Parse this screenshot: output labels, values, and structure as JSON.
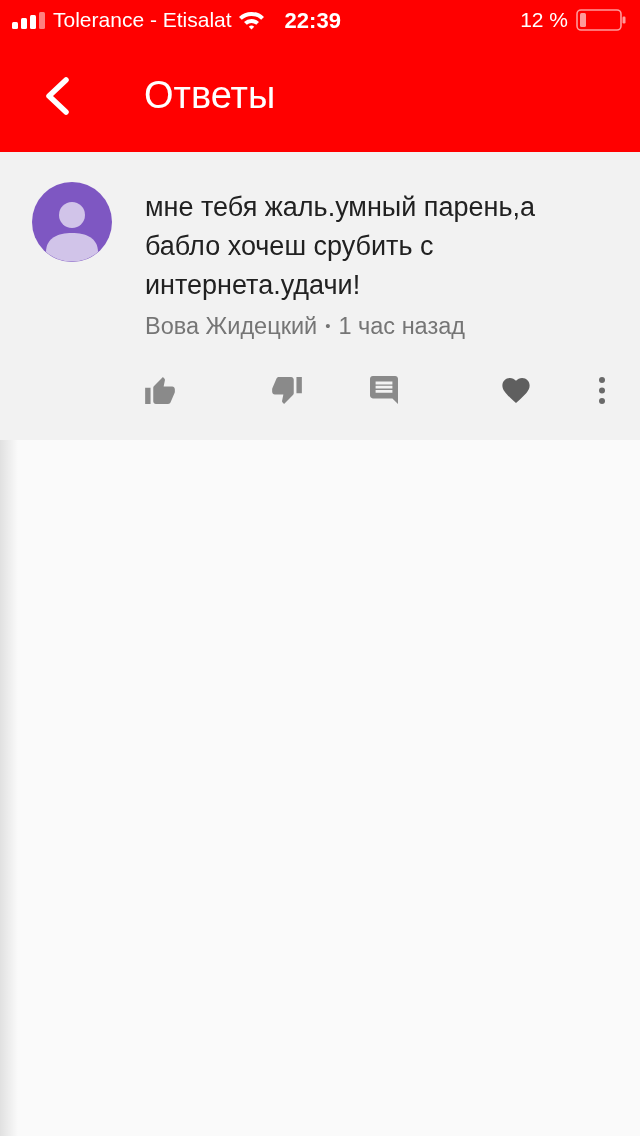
{
  "status_bar": {
    "carrier": "Tolerance - Etisalat",
    "time": "22:39",
    "battery": "12 %"
  },
  "header": {
    "title": "Ответы"
  },
  "comment": {
    "text": "мне тебя жаль.умный парень,а бабло хочеш срубить с интернета.удачи!",
    "author": "Вова Жидецкий",
    "separator": "•",
    "time": "1 час назад"
  },
  "actions": [
    {
      "kind": "like"
    },
    {
      "kind": "dislike"
    },
    {
      "kind": "reply"
    },
    {
      "kind": "heart"
    },
    {
      "kind": "more"
    }
  ]
}
